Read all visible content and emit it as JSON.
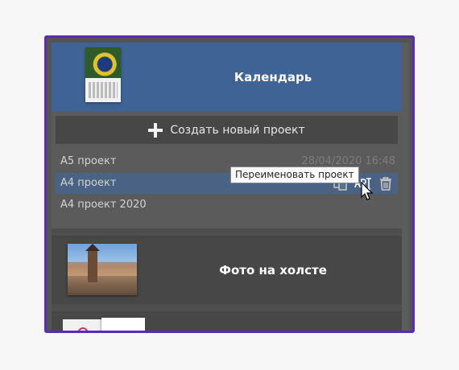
{
  "cards": {
    "calendar": {
      "title": "Календарь"
    },
    "create_button": {
      "label": "Создать новый проект"
    },
    "projects": [
      {
        "name": "A5 проект",
        "date": "28/04/2020 16:48"
      },
      {
        "name": "A4 проект"
      },
      {
        "name": "A4 проект 2020"
      }
    ],
    "canvas": {
      "title": "Фото на холсте"
    }
  },
  "tooltip": {
    "text": "Переименовать проект"
  },
  "icons": {
    "copy": "copy-icon",
    "rename": "rename-icon",
    "delete": "trash-icon",
    "add": "plus-icon"
  },
  "colors": {
    "selected_card": "#3e6394",
    "selected_row": "#4a6284",
    "frame_border": "#5a2bb8",
    "panel": "#4e4e4e"
  }
}
